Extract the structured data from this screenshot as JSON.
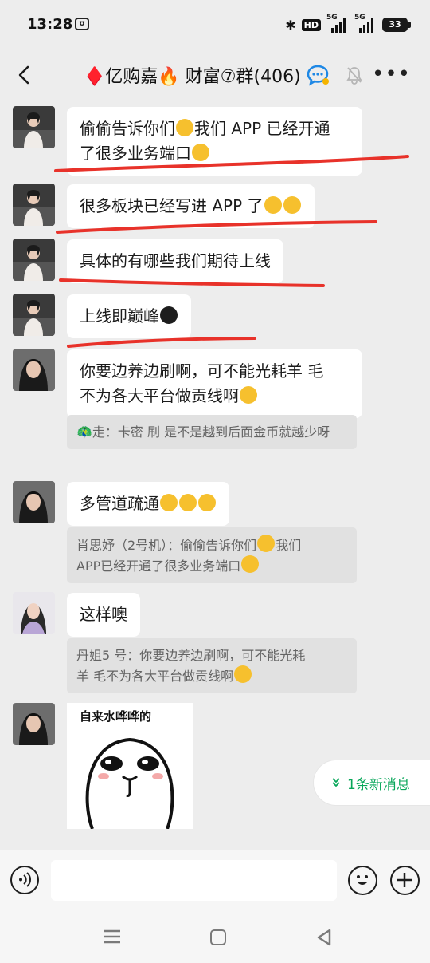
{
  "status_bar": {
    "time": "13:28",
    "app_indicator_icon": "app-notification-icon",
    "network_1": "5G",
    "network_2": "5G",
    "hd_label": "HD",
    "battery": "33"
  },
  "header": {
    "title": "♦️亿购嘉🔥 财富⑦群(406)",
    "title_icon": "group-chat-icon",
    "mute_icon": "muted-bell-icon",
    "more_icon": "more-icon"
  },
  "messages": [
    {
      "sender": "member-a",
      "text_1": "偷偷告诉你们",
      "text_2": "我们 APP 已经开通",
      "text_3": "了很多业务端口"
    },
    {
      "sender": "member-a",
      "text": "很多板块已经写进 APP 了"
    },
    {
      "sender": "member-a",
      "text": "具体的有哪些我们期待上线"
    },
    {
      "sender": "member-a",
      "text": "上线即巅峰"
    },
    {
      "sender": "member-b",
      "text_1": "你要边养边刷啊，可不能光耗羊 毛",
      "text_2": "不为各大平台做贡线啊"
    },
    {
      "quote": "🦚走：卡密 刷 是不是越到后面金币就越少呀"
    },
    {
      "sender": "member-b",
      "text": "多管道疏通"
    },
    {
      "quote_1": "肖思妤（2号机）：偷偷告诉你们",
      "quote_2": "我们",
      "quote_3": "APP已经开通了很多业务端口"
    },
    {
      "sender": "member-c",
      "text": "这样噢"
    },
    {
      "quote_1": "丹姐5 号：你要边养边刷啊，可不能光耗",
      "quote_2": "羊 毛不为各大平台做贡线啊"
    },
    {
      "sender": "member-b",
      "sticker_text": "自来水哗哗的"
    }
  ],
  "new_messages": {
    "label": "1条新消息"
  },
  "input": {
    "placeholder": ""
  },
  "colors": {
    "accent_green": "#07a659",
    "annotation_red": "#e8322a",
    "background": "#ededed"
  }
}
